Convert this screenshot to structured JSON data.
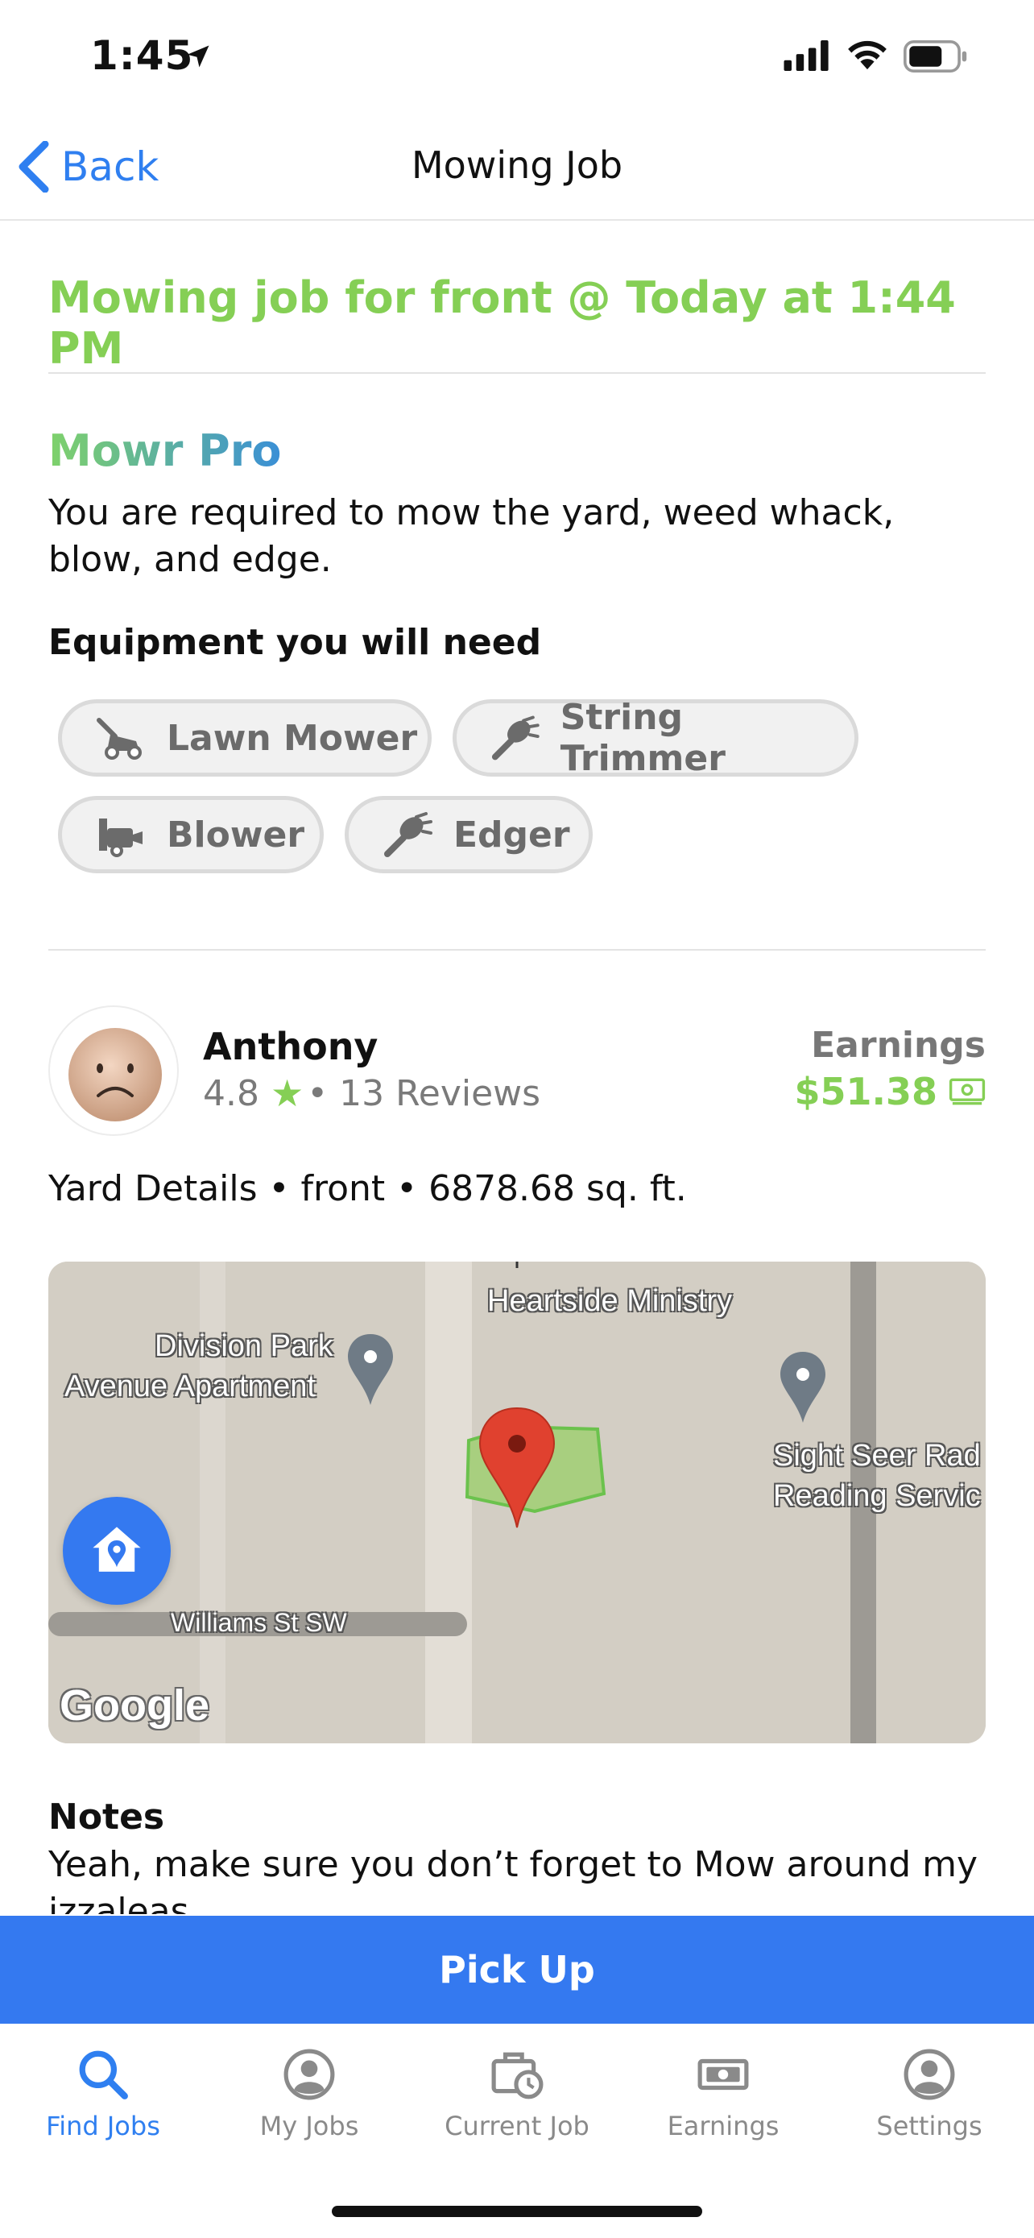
{
  "status_bar": {
    "time": "1:45"
  },
  "nav": {
    "back_label": "Back",
    "title": "Mowing Job"
  },
  "job": {
    "title": "Mowing job for front @ Today at 1:44 PM",
    "tier_name": "Mowr Pro",
    "tier_description": "You are required to mow the yard, weed whack, blow, and edge.",
    "equipment_heading": "Equipment you will need",
    "equipment": [
      {
        "label": "Lawn Mower",
        "icon": "lawn-mower-icon"
      },
      {
        "label": "String Trimmer",
        "icon": "string-trimmer-icon"
      },
      {
        "label": "Blower",
        "icon": "blower-icon"
      },
      {
        "label": "Edger",
        "icon": "edger-icon"
      }
    ]
  },
  "customer": {
    "name": "Anthony",
    "rating": "4.8",
    "reviews": "• 13 Reviews",
    "earnings_label": "Earnings",
    "earnings_amount": "$51.38"
  },
  "yard_details": "Yard Details • front • 6878.68 sq. ft.",
  "map": {
    "labels": {
      "heartside": "Heartside Ministry",
      "division_line1": "Division Park",
      "division_line2": "Avenue Apartment",
      "sightseer_line1": "Sight Seer Rad",
      "sightseer_line2": "Reading Servic",
      "street": "Williams St SW"
    },
    "provider": "Google"
  },
  "notes": {
    "heading": "Notes",
    "text": "Yeah, make sure you don’t forget to Mow around my izzaleas"
  },
  "pickup_label": "Pick Up",
  "tabs": [
    {
      "label": "Find Jobs",
      "icon": "search-icon",
      "active": true
    },
    {
      "label": "My Jobs",
      "icon": "user-circle-icon",
      "active": false
    },
    {
      "label": "Current Job",
      "icon": "briefcase-clock-icon",
      "active": false
    },
    {
      "label": "Earnings",
      "icon": "money-icon",
      "active": false
    },
    {
      "label": "Settings",
      "icon": "user-circle-icon",
      "active": false
    }
  ],
  "colors": {
    "accent_green": "#85cf55",
    "primary_blue": "#3479f0",
    "link_blue": "#2f7ff0"
  }
}
